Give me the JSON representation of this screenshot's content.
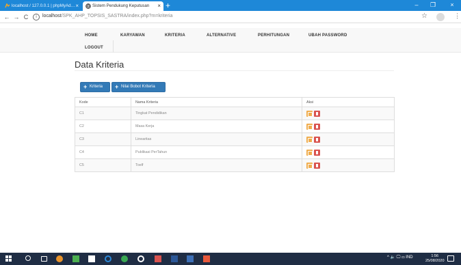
{
  "browser": {
    "tabs": [
      {
        "title": "localhost / 127.0.0.1 | phpMyAd…",
        "close": "×"
      },
      {
        "title": "Sistem Pendukung Keputusan",
        "close": "×"
      }
    ],
    "new_tab": "+",
    "window_controls": {
      "minimize": "–",
      "maximize": "❐",
      "close": "×"
    },
    "nav": {
      "back": "←",
      "forward": "→",
      "reload": "C"
    },
    "url_host": "localhost",
    "url_path": "/SPK_AHP_TOPSIS_SASTRA/index.php?m=kriteria",
    "info_glyph": "i",
    "bookmark_glyph": "☆",
    "menu_glyph": "⋮"
  },
  "navbar": {
    "items": [
      "HOME",
      "KARYAWAN",
      "KRITERIA",
      "ALTERNATIVE",
      "PERHITUNGAN",
      "UBAH PASSWORD",
      "LOGOUT"
    ]
  },
  "page": {
    "title": "Data Kriteria",
    "buttons": {
      "add_kriteria": "Kriteria",
      "nilai_bobot": "Nilai Bobot Kriteria",
      "plus": "+"
    }
  },
  "table": {
    "headers": [
      "Kode",
      "Nama Kriteria",
      "Aksi"
    ],
    "rows": [
      {
        "kode": "C1",
        "nama": "Tingkat Pendidikan"
      },
      {
        "kode": "C2",
        "nama": "Masa Kerja"
      },
      {
        "kode": "C3",
        "nama": "Linearitas"
      },
      {
        "kode": "C4",
        "nama": "Publikasi PerTahun"
      },
      {
        "kode": "C5",
        "nama": "Toelf"
      }
    ]
  },
  "taskbar": {
    "tray": "^ 🔈 🖵 ▭ IND",
    "time": "1:56",
    "date": "25/08/2020"
  },
  "colors": {
    "primary": "#337ab7",
    "warning": "#f0ad4e",
    "danger": "#d9534f",
    "chrome_tabstrip": "#1e88d8",
    "taskbar": "#1f2d44"
  }
}
